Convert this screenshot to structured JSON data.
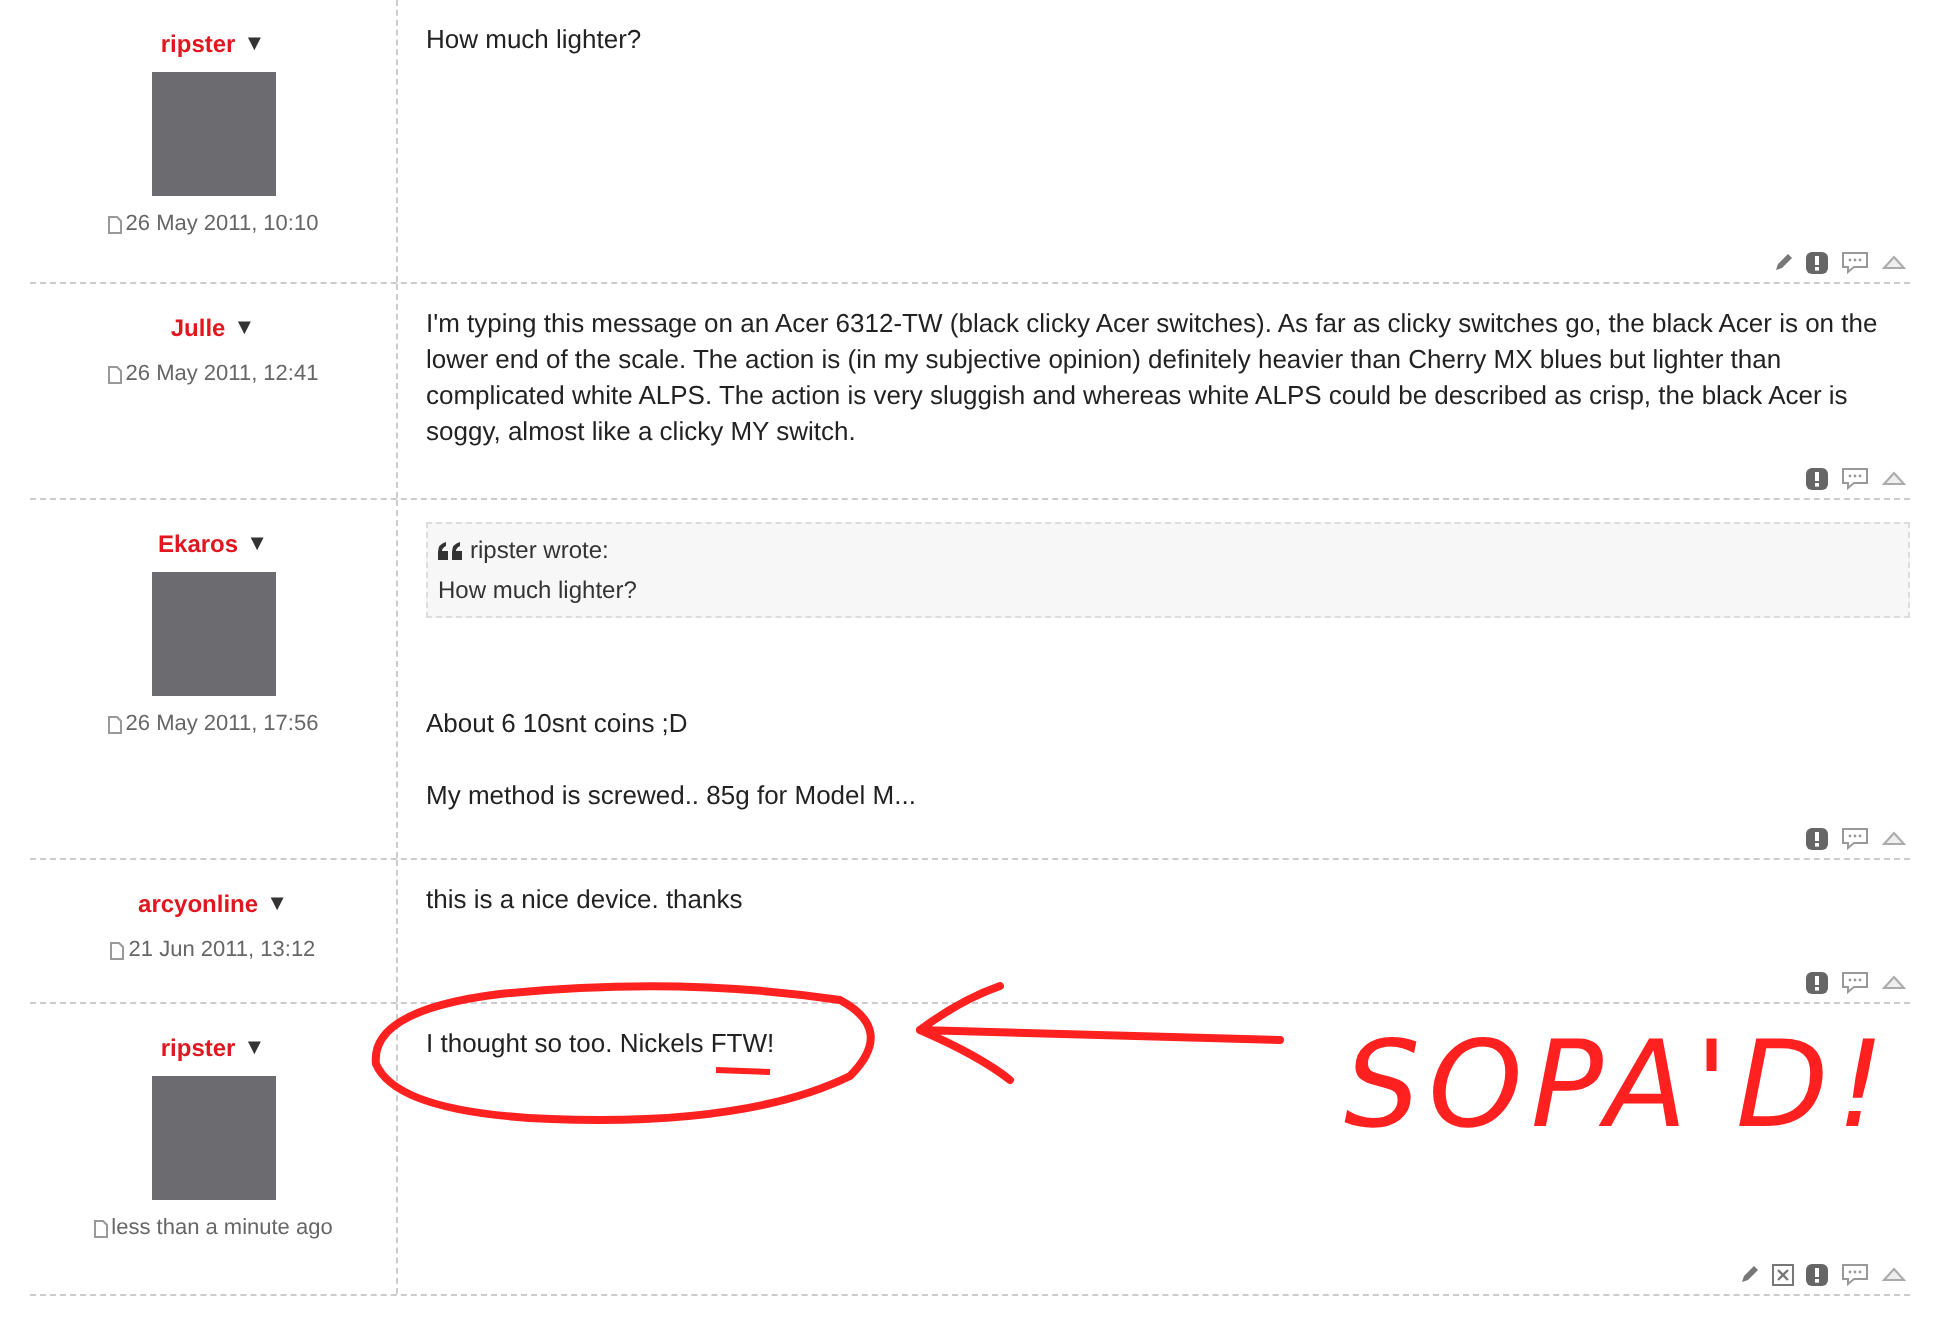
{
  "posts": [
    {
      "author": "ripster",
      "menu_glyph": "▼",
      "avatar": true,
      "date": "26 May 2011, 10:10",
      "paragraphs": [
        "How much lighter?"
      ],
      "actions": [
        {
          "kind": "edit"
        },
        {
          "kind": "report"
        },
        {
          "kind": "quote"
        },
        {
          "kind": "top"
        }
      ]
    },
    {
      "author": "Julle",
      "menu_glyph": "▼",
      "avatar": false,
      "date": "26 May 2011, 12:41",
      "paragraphs": [
        "I'm typing this message on an Acer 6312-TW (black clicky Acer switches). As far as clicky switches go, the black Acer is on the lower end of the scale. The action is (in my subjective opinion) definitely heavier than Cherry MX blues but lighter than complicated white ALPS. The action is very sluggish and whereas white ALPS could be described as crisp, the black Acer is soggy, almost like a clicky MY switch."
      ],
      "actions": [
        {
          "kind": "report"
        },
        {
          "kind": "quote"
        },
        {
          "kind": "top"
        }
      ]
    },
    {
      "author": "Ekaros",
      "menu_glyph": "▼",
      "avatar": true,
      "date": "26 May 2011, 17:56",
      "quote": {
        "author_line": "ripster wrote:",
        "text": "How much lighter?"
      },
      "paragraphs": [
        "About 6 10snt coins ;D",
        "My method is screwed.. 85g for Model M..."
      ],
      "actions": [
        {
          "kind": "report"
        },
        {
          "kind": "quote"
        },
        {
          "kind": "top"
        }
      ]
    },
    {
      "author": "arcyonline",
      "menu_glyph": "▼",
      "avatar": false,
      "date": "21 Jun 2011, 13:12",
      "paragraphs": [
        "this is a nice device. thanks"
      ],
      "actions": [
        {
          "kind": "report"
        },
        {
          "kind": "quote"
        },
        {
          "kind": "top"
        }
      ]
    },
    {
      "author": "ripster",
      "menu_glyph": "▼",
      "avatar": true,
      "date": "less than a minute ago",
      "paragraphs": [
        "I thought so too. Nickels FTW!"
      ],
      "actions": [
        {
          "kind": "edit"
        },
        {
          "kind": "delete"
        },
        {
          "kind": "report"
        },
        {
          "kind": "quote"
        },
        {
          "kind": "top"
        }
      ]
    }
  ],
  "annotation": {
    "text": "SOPA'D!"
  }
}
